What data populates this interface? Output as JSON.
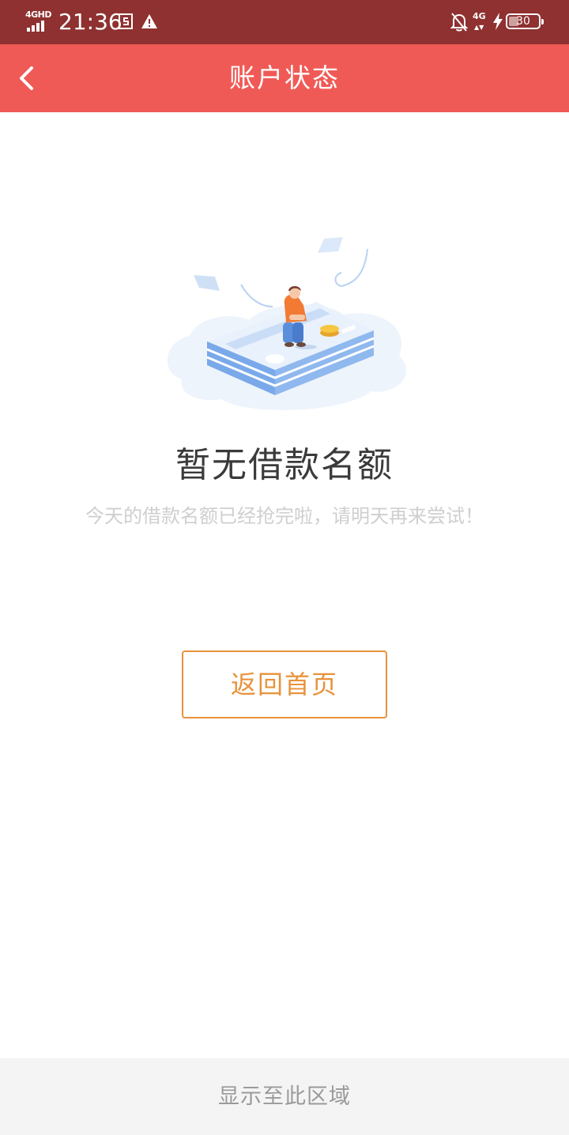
{
  "status_bar": {
    "network_label": "4GHD",
    "time": "21:36",
    "mobile_data_label": "4G",
    "battery_level": "30"
  },
  "nav": {
    "title": "账户状态"
  },
  "empty_state": {
    "title": "暂无借款名额",
    "description": "今天的借款名额已经抢完啦，请明天再来尝试！",
    "button_label": "返回首页"
  },
  "bottom_bar": {
    "label": "显示至此区域"
  },
  "colors": {
    "status_bar": "#8e3130",
    "nav_bar": "#f05a56",
    "button_accent": "#e8923b",
    "bottom_bar": "#f4f4f4"
  },
  "icons": {
    "back": "chevron-left-icon",
    "notification_off": "bell-off-icon",
    "warning": "warning-icon",
    "charging": "bolt-icon"
  }
}
